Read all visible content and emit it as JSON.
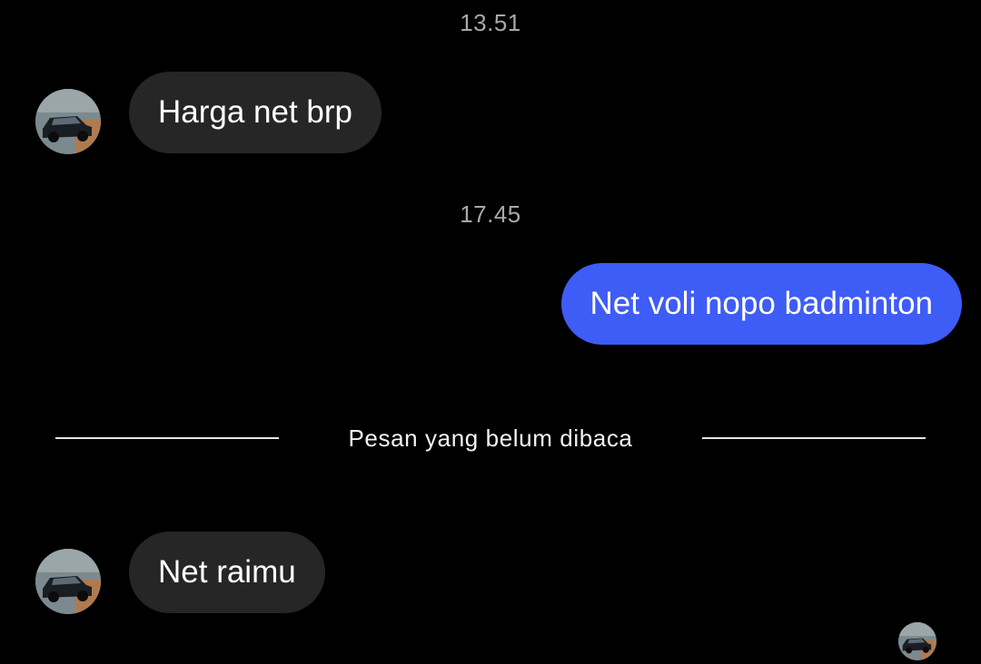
{
  "conversation": {
    "timestamps": [
      "13.51",
      "17.45"
    ],
    "messages": [
      {
        "direction": "incoming",
        "text": "Harga net brp"
      },
      {
        "direction": "outgoing",
        "text": "Net voli nopo badminton"
      },
      {
        "direction": "incoming",
        "text": "Net raimu"
      }
    ],
    "unread_divider": "Pesan yang belum dibaca"
  },
  "colors": {
    "background": "#000000",
    "incoming_bubble": "#262626",
    "outgoing_bubble": "#3e5cf6",
    "timestamp_text": "#a8a8a8"
  },
  "icons": {
    "contact_avatar": "car-photo-avatar",
    "seen_indicator": "seen-avatar"
  }
}
